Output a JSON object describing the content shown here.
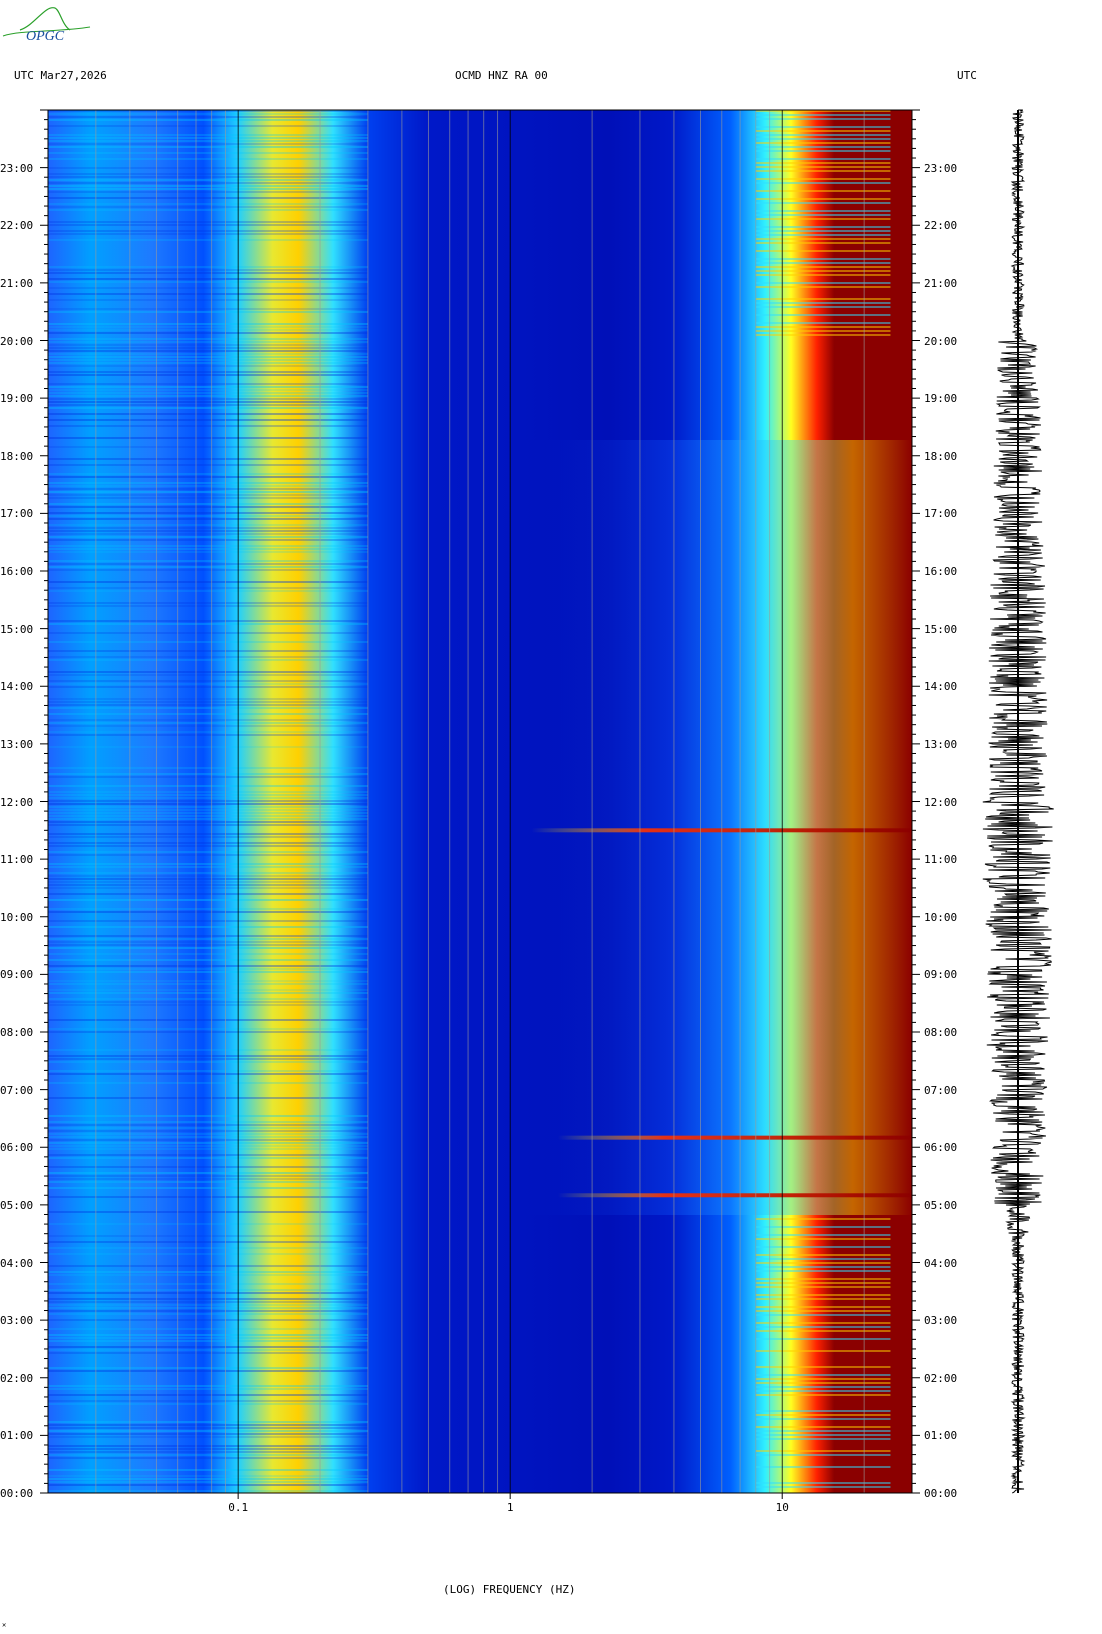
{
  "header": {
    "left": "UTC  Mar27,2026",
    "center": "OCMD HNZ RA 00",
    "right": "UTC"
  },
  "logo": {
    "text": "OPGC"
  },
  "colors": {
    "background": "#ffffff",
    "deep_blue": "#0000a8",
    "blue": "#0046ff",
    "cyan": "#00e0ff",
    "yellow": "#ffff00",
    "red": "#ff0000",
    "dark_red": "#8b0000",
    "gridline": "#9a9a9a",
    "seismogram": "#000000"
  },
  "chart_data": {
    "type": "heatmap",
    "title": "OCMD HNZ RA 00",
    "xlabel": "(LOG) FREQUENCY (HZ)",
    "ylabel": "UTC",
    "x_scale": "log",
    "xlim": [
      0.02,
      30
    ],
    "ylim": [
      "00:00",
      "24:00"
    ],
    "x_ticks": [
      "0.1",
      "1",
      "10"
    ],
    "y_ticks": [
      "00:00",
      "01:00",
      "02:00",
      "03:00",
      "04:00",
      "05:00",
      "06:00",
      "07:00",
      "08:00",
      "09:00",
      "10:00",
      "11:00",
      "12:00",
      "13:00",
      "14:00",
      "15:00",
      "16:00",
      "17:00",
      "18:00",
      "19:00",
      "20:00",
      "21:00",
      "22:00",
      "23:00"
    ],
    "colormap": [
      "#0000a8",
      "#0046ff",
      "#00e0ff",
      "#ffff00",
      "#ff0000",
      "#8b0000"
    ],
    "features": [
      {
        "name": "microseism band",
        "freq_range_hz": [
          0.12,
          0.22
        ],
        "level": "yellow"
      },
      {
        "name": "long period band",
        "freq_range_hz": [
          0.02,
          0.05
        ],
        "level": "cyan"
      },
      {
        "name": "high frequency noise",
        "freq_range_hz": [
          8,
          30
        ],
        "level": "dark_red"
      },
      {
        "name": "daytime broadband activity",
        "time_range_utc": [
          "05:00",
          "20:00"
        ],
        "freq_range_hz": [
          1.2,
          30
        ]
      },
      {
        "name": "event",
        "time_utc": "05:10",
        "freq_range_hz": [
          1.5,
          30
        ]
      },
      {
        "name": "event",
        "time_utc": "06:10",
        "freq_range_hz": [
          1.5,
          30
        ]
      },
      {
        "name": "event",
        "time_utc": "11:30",
        "freq_range_hz": [
          1.2,
          30
        ]
      }
    ]
  }
}
